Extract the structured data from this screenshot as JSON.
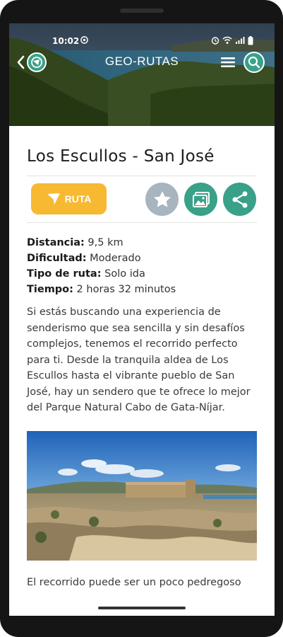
{
  "status_bar": {
    "time": "10:02"
  },
  "app_bar": {
    "title": "GEO-RUTAS"
  },
  "route": {
    "title": "Los Escullos - San José",
    "ruta_label": "RUTA",
    "specs": [
      {
        "label": "Distancia:",
        "value": " 9,5 km"
      },
      {
        "label": "Dificultad:",
        "value": " Moderado"
      },
      {
        "label": "Tipo de ruta:",
        "value": " Solo ida"
      },
      {
        "label": "Tiempo:",
        "value": " 2 horas 32 minutos"
      }
    ],
    "description": "Si estás buscando una experiencia de senderismo que sea sencilla y sin desafíos complejos, tenemos el recorrido perfecto para ti. Desde la tranquila aldea de Los Escullos hasta el vibrante pueblo de San José, hay un sendero que te ofrece lo mejor del Parque Natural Cabo de Gata-Níjar.",
    "description_2": "El recorrido puede ser un poco pedregoso"
  },
  "colors": {
    "accent_yellow": "#f7b832",
    "accent_green": "#39a188",
    "fav_gray": "#a8b4be"
  },
  "icons": [
    "back-icon",
    "menu-icon",
    "search-icon",
    "navigation-arrow-icon",
    "star-icon",
    "image-icon",
    "share-icon"
  ]
}
